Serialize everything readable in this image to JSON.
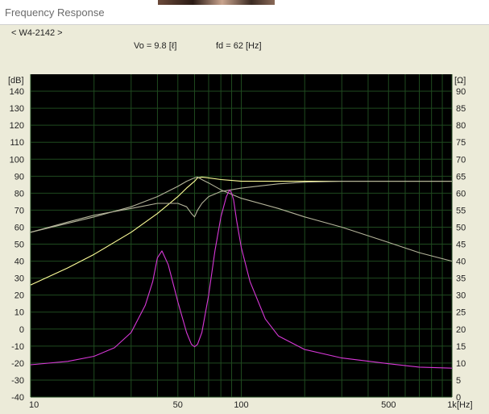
{
  "window": {
    "title": "Frequency Response"
  },
  "header": {
    "model_tag": "< W4-2142 >",
    "vo_label": "Vo = 9.8 [ℓ]",
    "fd_label": "fd   = 62 [Hz]"
  },
  "colors": {
    "plot_bg": "#000000",
    "grid": "#1f4a1f",
    "spl_total": "#ffff99",
    "spl_component": "#b4b49a",
    "impedance": "#d838d8"
  },
  "chart_data": {
    "type": "line",
    "xscale": "log",
    "xlim": [
      10,
      1000
    ],
    "x_ticks": [
      {
        "v": 10,
        "label": "10"
      },
      {
        "v": 50,
        "label": "50"
      },
      {
        "v": 100,
        "label": "100"
      },
      {
        "v": 500,
        "label": "500"
      },
      {
        "v": 1000,
        "label": "1k"
      }
    ],
    "x_unit": "[Hz]",
    "y_left": {
      "unit": "[dB]",
      "lim": [
        -40,
        150
      ],
      "ticks": [
        140,
        130,
        120,
        110,
        100,
        90,
        80,
        70,
        60,
        50,
        40,
        30,
        20,
        10,
        0,
        -10,
        -20,
        -30,
        -40
      ]
    },
    "y_right": {
      "unit": "[Ω]",
      "lim": [
        0,
        95
      ],
      "ticks": [
        90,
        85,
        80,
        75,
        70,
        65,
        60,
        55,
        50,
        45,
        40,
        35,
        30,
        25,
        20,
        15,
        10,
        5,
        0
      ]
    },
    "series": [
      {
        "color": "#ffff99",
        "axis": "left",
        "x": [
          10,
          15,
          20,
          30,
          40,
          50,
          55,
          60,
          62,
          65,
          70,
          80,
          90,
          100,
          150,
          200,
          300,
          500,
          700,
          1000
        ],
        "y": [
          26,
          36,
          44,
          57,
          68,
          78,
          83,
          87,
          89,
          89.5,
          89,
          88,
          87.5,
          87,
          87,
          87,
          87,
          87,
          87,
          87
        ]
      },
      {
        "color": "#b4b49a",
        "axis": "left",
        "x": [
          10,
          15,
          20,
          30,
          40,
          50,
          55,
          58,
          60,
          62,
          65,
          70,
          80,
          100,
          150,
          200,
          300,
          500,
          700,
          1000
        ],
        "y": [
          57,
          63,
          67,
          71,
          74,
          74,
          72,
          68,
          66,
          70,
          74,
          78,
          81,
          83,
          85.5,
          86.5,
          87,
          87,
          87,
          87
        ]
      },
      {
        "color": "#b4b49a",
        "axis": "left",
        "x": [
          10,
          20,
          30,
          40,
          50,
          55,
          60,
          62,
          65,
          70,
          80,
          100,
          150,
          200,
          300,
          500,
          700,
          1000
        ],
        "y": [
          57,
          66,
          72,
          78,
          84,
          87,
          89,
          89.5,
          88,
          86,
          82,
          77,
          71,
          66,
          60,
          51,
          45,
          40
        ]
      },
      {
        "color": "#d838d8",
        "axis": "right",
        "x": [
          10,
          15,
          20,
          25,
          30,
          35,
          38,
          40,
          42,
          45,
          50,
          55,
          58,
          60,
          62,
          65,
          70,
          75,
          80,
          85,
          88,
          90,
          92,
          95,
          100,
          110,
          130,
          150,
          200,
          300,
          500,
          700,
          1000
        ],
        "y": [
          9.5,
          10.5,
          12,
          14.5,
          19,
          27,
          34,
          41,
          43,
          39,
          28,
          19,
          15.5,
          14.8,
          15.5,
          19,
          30,
          43,
          53,
          59,
          61,
          60,
          58,
          52,
          44,
          34,
          23,
          18,
          14,
          11.5,
          9.8,
          8.8,
          8.5
        ]
      }
    ]
  }
}
